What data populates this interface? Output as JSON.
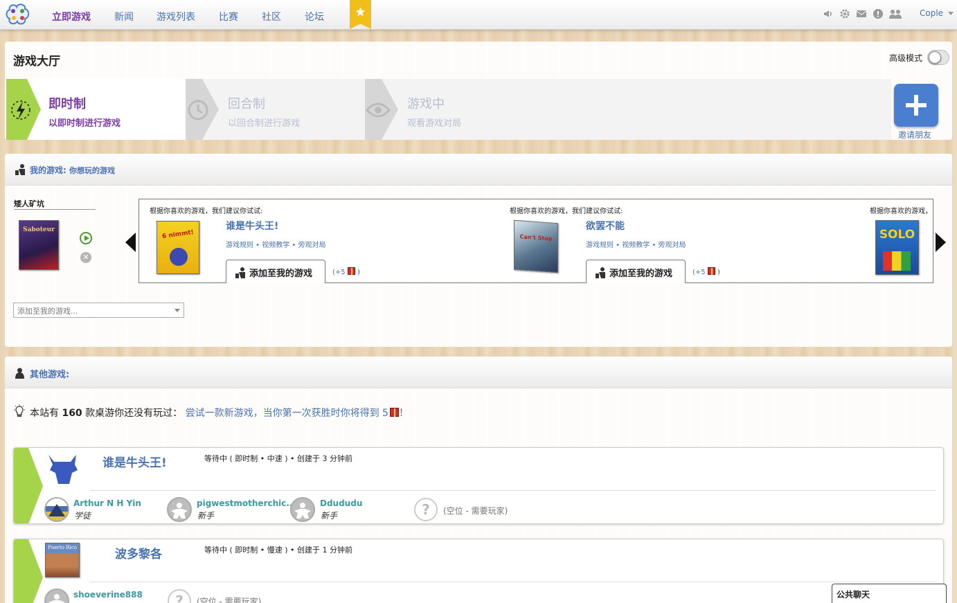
{
  "nav": {
    "items": [
      "立即游戏",
      "新闻",
      "游戏列表",
      "比赛",
      "社区",
      "论坛"
    ],
    "active_index": 0,
    "user": "Cople",
    "icons": [
      "sound-icon",
      "settings-icon",
      "mail-icon",
      "info-icon",
      "friends-icon"
    ]
  },
  "lobby": {
    "title": "游戏大厅",
    "advanced_mode_label": "高级模式",
    "advanced_mode_on": false,
    "modes": [
      {
        "title": "即时制",
        "subtitle": "以即时制进行游戏"
      },
      {
        "title": "回合制",
        "subtitle": "以回合制进行游戏"
      },
      {
        "title": "游戏中",
        "subtitle": "观看游戏对局"
      }
    ],
    "invite_label": "邀请朋友"
  },
  "my_games": {
    "title": "我的游戏:",
    "subtitle": "你想玩的游戏",
    "waiting_game": "矮人矿坑",
    "waiting_box_text": "Saboteur",
    "add_placeholder": "添加至我的游戏...",
    "suggestions": [
      {
        "intro": "根据你喜欢的游戏，我们建议你试试:",
        "title": "谁是牛头王!",
        "box_text": "6 nimmt!",
        "links": "游戏规则 • 视频教学 • 旁观对局",
        "add_label": "添加至我的游戏",
        "bonus": "(+5",
        "bonus_close": ")"
      },
      {
        "intro": "根据你喜欢的游戏，我们建议你试试:",
        "title": "欲罢不能",
        "box_text": "Can't Stop",
        "links": "游戏规则 • 视频教学 • 旁观对局",
        "add_label": "添加至我的游戏",
        "bonus": "(+5",
        "bonus_close": ")"
      },
      {
        "intro": "根据你喜欢的游戏，",
        "box_text": "SOLO"
      }
    ]
  },
  "other_games": {
    "title": "其他游戏:",
    "tip_prefix": "本站有",
    "tip_count": "160",
    "tip_middle": "款桌游你还没有玩过：",
    "tip_link": "尝试一款新游戏，当你第一次获胜时你将得到 5",
    "tip_end": "！",
    "tables": [
      {
        "name": "谁是牛头王!",
        "status": "等待中 ( 即时制 • 中速 ) • 创建于 3 分钟前",
        "players": [
          {
            "name": "Arthur N H Yin",
            "rank": "学徒"
          },
          {
            "name": "pigwestmotherchic...",
            "rank": "新手"
          },
          {
            "name": "Ddududu",
            "rank": "新手"
          }
        ],
        "empty_label": "(空位 - 需要玩家)"
      },
      {
        "name": "波多黎各",
        "box_text": "Puerto Rico",
        "status": "等待中 ( 即时制 • 慢速 ) • 创建于 1 分钟前",
        "players": [
          {
            "name": "shoeverine888",
            "rank": ""
          }
        ],
        "empty_label": "(空位 - 需要玩家)"
      }
    ]
  },
  "chat": {
    "label": "公共聊天"
  },
  "colors": {
    "accent_purple": "#7a3fa5",
    "link_blue": "#4a72b0",
    "green_chevron": "#a5d44a",
    "invite_blue": "#4a7fd0",
    "player_teal": "#3a9aa0"
  }
}
